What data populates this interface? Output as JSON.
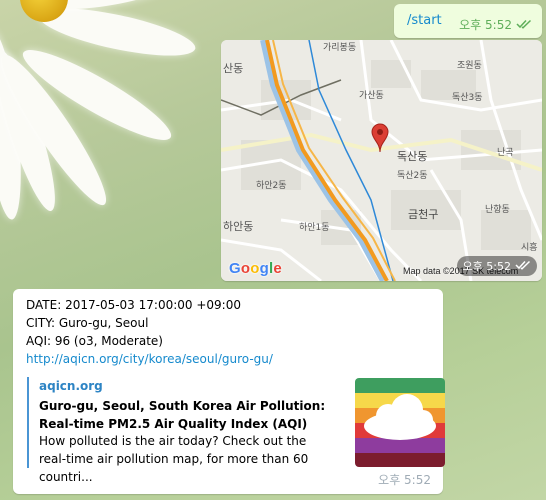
{
  "outgoing": {
    "command": "/start",
    "time": "오후 5:52",
    "status_icon": "double-check-icon"
  },
  "location": {
    "google_logo": "Google",
    "attribution": "Map data ©2017 SK telecom",
    "time": "오후 5:52",
    "labels": {
      "garibong": "가리봉동",
      "sindong": "산동",
      "jowondong": "조원동",
      "gasandong": "가산동",
      "doksan3": "독산3동",
      "doksandong": "독산동",
      "doksan2": "독산2동",
      "nangok": "난곡",
      "haan2": "하안2동",
      "haan": "하안동",
      "nanhyang": "난향동",
      "geumcheongu": "금천구",
      "haan1": "하안1동",
      "siheung": "시흥"
    },
    "colors": {
      "rail": "#2e89d8",
      "highway": "#f29a1f",
      "pin": "#db3e34"
    }
  },
  "incoming": {
    "date_line": "DATE: 2017-05-03 17:00:00 +09:00",
    "city_line": "CITY: Guro-gu, Seoul",
    "aqi_line": "AQI: 96 (o3, Moderate)",
    "url": "http://aqicn.org/city/korea/seoul/guro-gu/",
    "preview": {
      "site": "aqicn.org",
      "title": "Guro-gu, Seoul, South Korea Air Pollution: Real-time PM2.5 Air Quality Index (AQI)",
      "description": "How polluted is the air today? Check out the real-time air pollution map, for more than 60 countri...",
      "thumb_colors": [
        "#3e9e5f",
        "#f6d84a",
        "#f0962f",
        "#e03a3a",
        "#8e3c9e",
        "#7c1d2e"
      ]
    },
    "time": "오후 5:52"
  }
}
